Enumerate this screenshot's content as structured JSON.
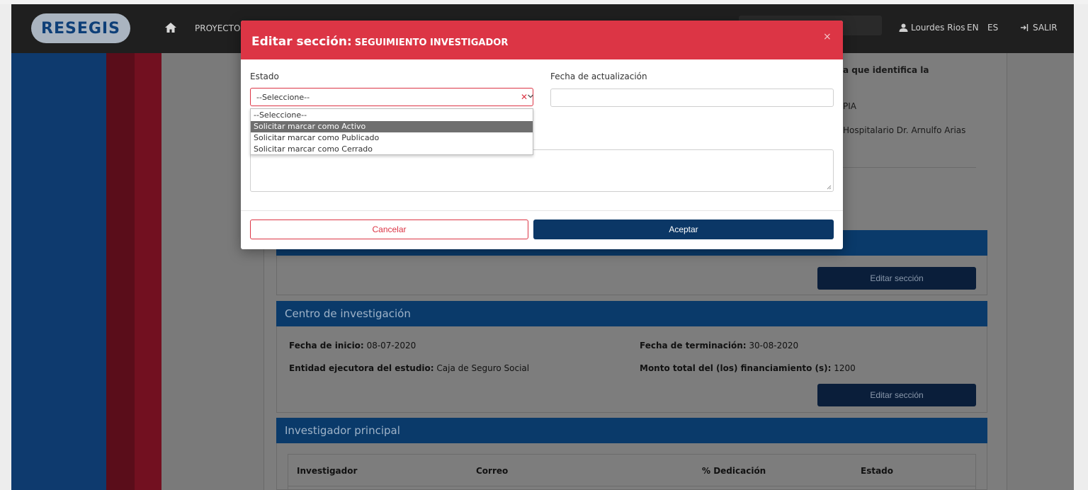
{
  "navbar": {
    "logo_text": "RESEGIS",
    "projects_label": "PROYECTO",
    "user_name": "Lourdes Rios",
    "lang_en": "EN",
    "lang_es": "ES",
    "logout_label": "SALIR"
  },
  "background": {
    "identify_text": "a que identifica la",
    "pia_text": "PIA",
    "hospital_text": "Hospitalario Dr. Arnulfo Arias",
    "edit_section_label": "Editar sección",
    "research_center": {
      "title": "Centro de investigación",
      "start_date_label": "Fecha de inicio:",
      "start_date_value": "08-07-2020",
      "end_date_label": "Fecha de terminación:",
      "end_date_value": "30-08-2020",
      "entity_label": "Entidad ejecutora del estudio:",
      "entity_value": "Caja de Seguro Social",
      "funding_label": "Monto total del (los) financiamiento (s):",
      "funding_value": "1200"
    },
    "principal_investigator": {
      "title": "Investigador principal",
      "columns": [
        "Investigador",
        "Correo",
        "% Dedicación",
        "Estado"
      ]
    }
  },
  "modal": {
    "title": "Editar sección:",
    "title_suffix": "SEGUIMIENTO INVESTIGADOR",
    "close_symbol": "×",
    "status_label": "Estado",
    "status_selected": "--Seleccione--",
    "status_options": [
      "--Seleccione--",
      "Solicitar marcar como Activo",
      "Solicitar marcar como Publicado",
      "Solicitar marcar como Cerrado"
    ],
    "highlighted_option_index": 1,
    "date_label": "Fecha de actualización",
    "date_value": "",
    "cancel_label": "Cancelar",
    "accept_label": "Aceptar"
  },
  "colors": {
    "modal_header": "#dc3545",
    "primary_blue": "#0b3766",
    "navbar": "#1f1f1f"
  }
}
